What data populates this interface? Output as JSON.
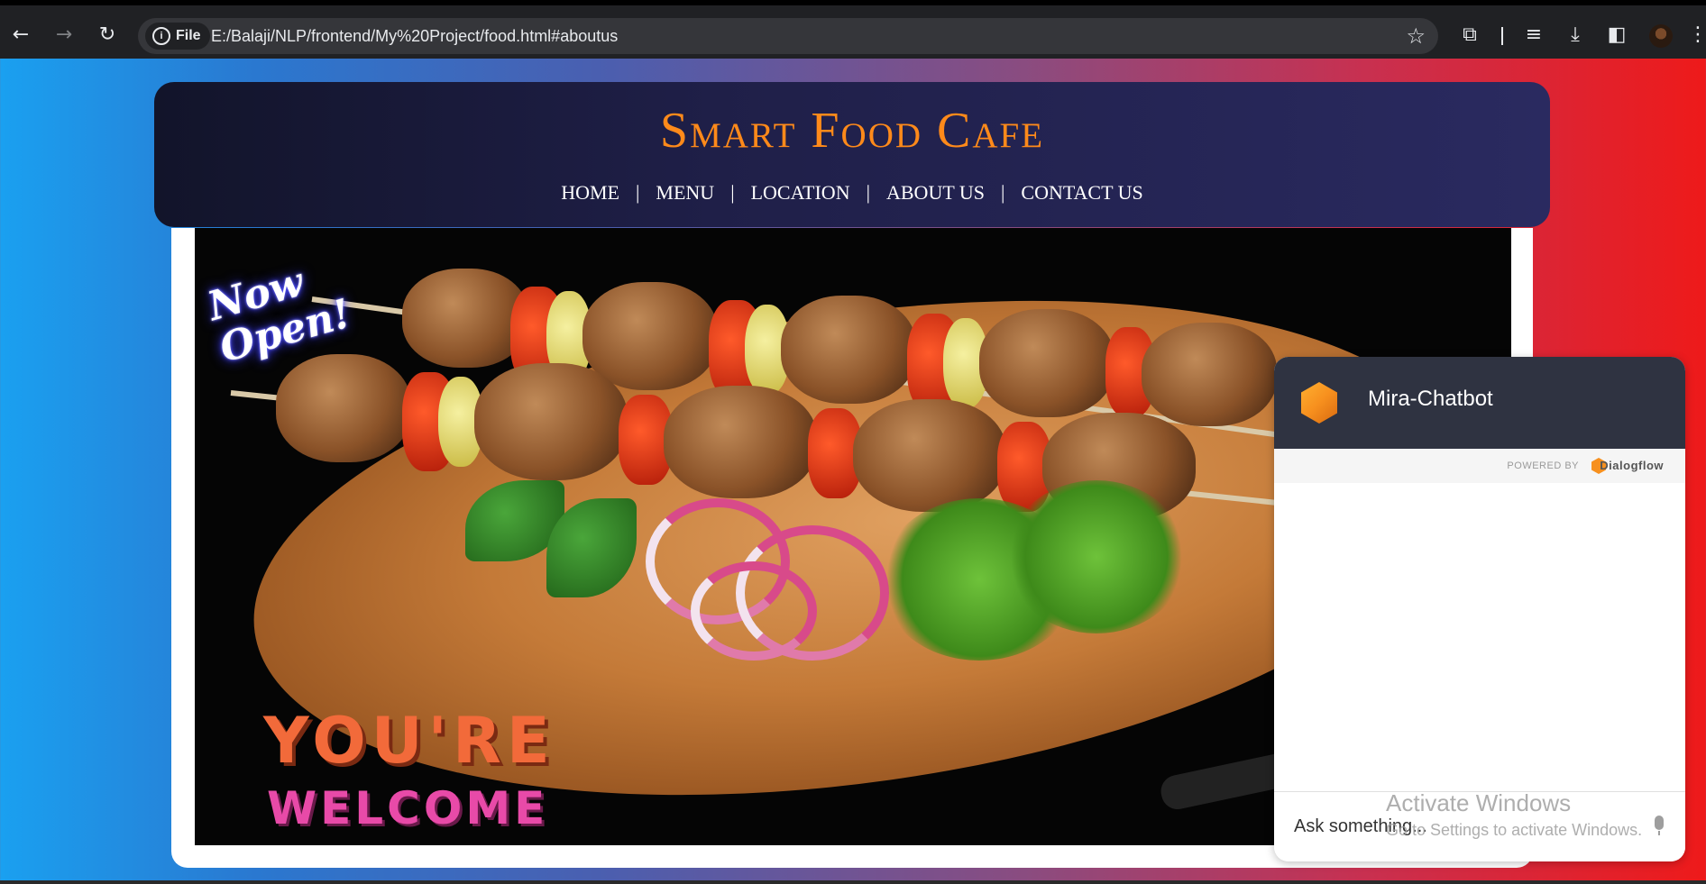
{
  "browser": {
    "back_icon": "arrow-left",
    "forward_icon": "arrow-right",
    "reload_icon": "reload",
    "file_chip_label": "File",
    "url": "E:/Balaji/NLP/frontend/My%20Project/food.html#aboutus",
    "bookmark_icon": "star"
  },
  "header": {
    "title": "Smart Food Cafe",
    "nav": [
      {
        "label": "HOME"
      },
      {
        "label": "MENU"
      },
      {
        "label": "LOCATION"
      },
      {
        "label": "ABOUT US"
      },
      {
        "label": "CONTACT US"
      }
    ],
    "separator": "|",
    "title_color": "#ff8a1a"
  },
  "hero": {
    "badge": "Now Open!",
    "headline_top": "YOU'RE",
    "headline_bottom": "WELCOME"
  },
  "chatbot": {
    "name": "Mira-Chatbot",
    "powered_by_label": "POWERED BY",
    "provider": "Dialogflow",
    "input_placeholder": "Ask something...",
    "accent_color": "#f7901e"
  },
  "watermark": {
    "title": "Activate Windows",
    "subtitle": "Go to Settings to activate Windows."
  }
}
